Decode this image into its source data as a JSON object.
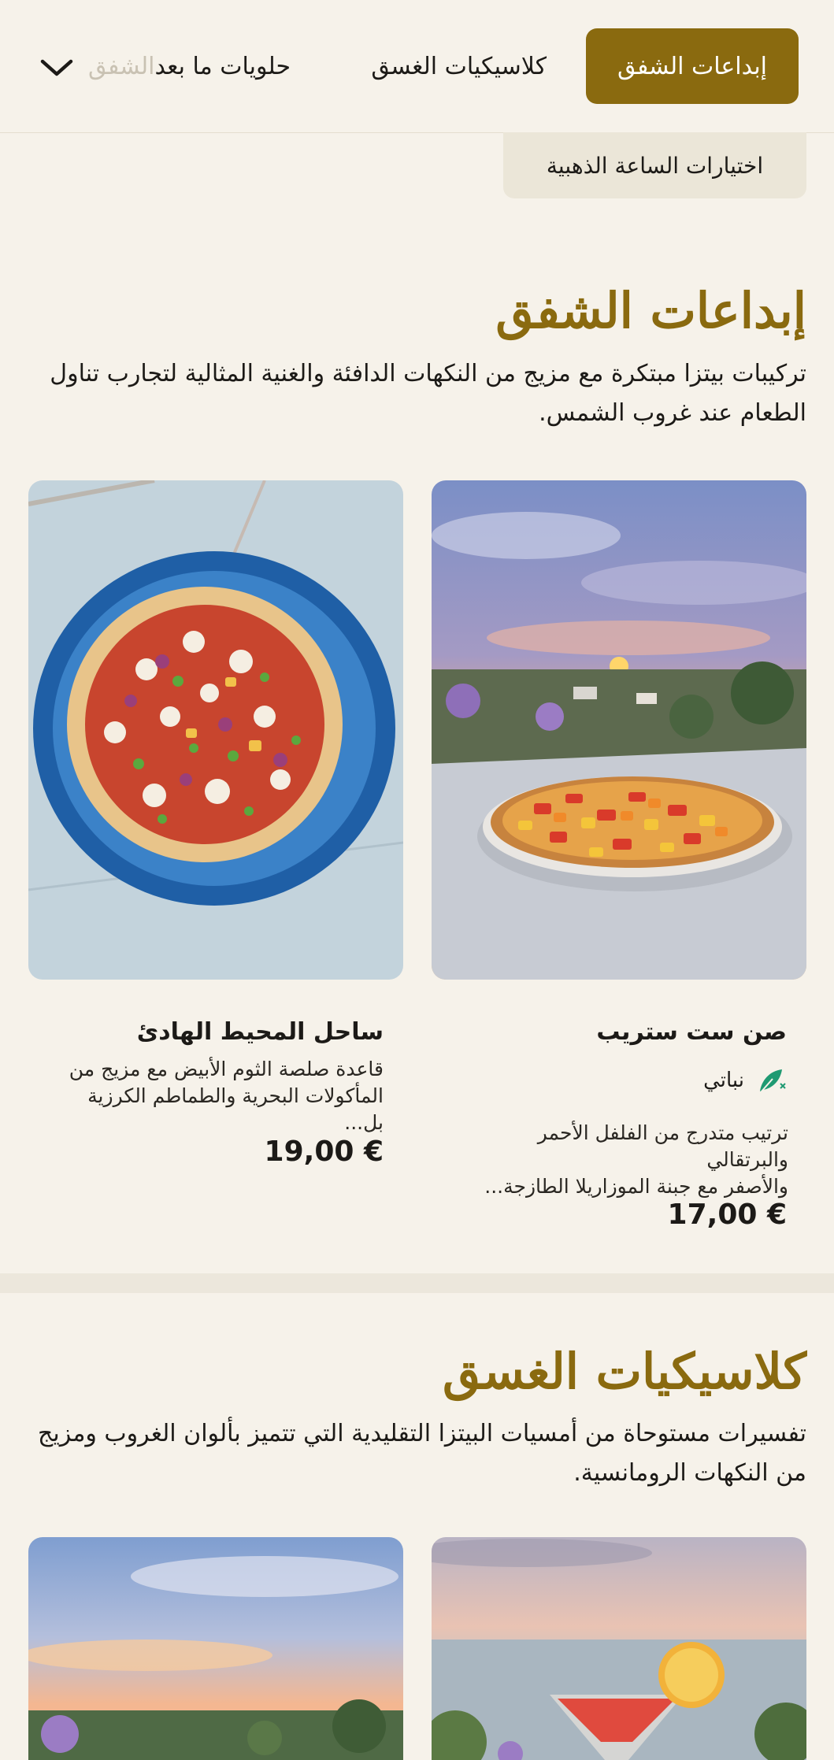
{
  "tabs": {
    "active": "إبداعات الشفق",
    "second": "كلاسيكيات الغسق",
    "third_visible": "حلويات ما بعد ",
    "third_fade": "الشفق"
  },
  "subtab": "اختيارات الساعة الذهبية",
  "section1": {
    "title": "إبداعات الشفق",
    "description": "تركيبات بيتزا مبتكرة مع مزيج من النكهات الدافئة والغنية المثالية لتجارب تناول الطعام عند غروب الشمس."
  },
  "items": [
    {
      "name": "صن ست ستريب",
      "tag": "نباتي",
      "description_line1": "ترتيب متدرج من الفلفل الأحمر والبرتقالي",
      "description_line2": "والأصفر مع جبنة الموزاريلا الطازجة...",
      "price": "17,00 €"
    },
    {
      "name": "ساحل المحيط الهادئ",
      "description_line1": "قاعدة صلصة الثوم الأبيض مع مزيج من",
      "description_line2": "المأكولات البحرية والطماطم الكرزية بل...",
      "price": "19,00 €"
    }
  ],
  "section2": {
    "title": "كلاسيكيات الغسق",
    "description": "تفسيرات مستوحاة من أمسيات البيتزا التقليدية التي تتميز بألوان الغروب ومزيج من النكهات الرومانسية."
  },
  "colors": {
    "accent": "#8a6a0f",
    "background": "#f6f2ea",
    "veg_icon": "#1f9a72"
  },
  "icons": [
    "chevron-down-icon",
    "vegan-leaf-icon"
  ]
}
